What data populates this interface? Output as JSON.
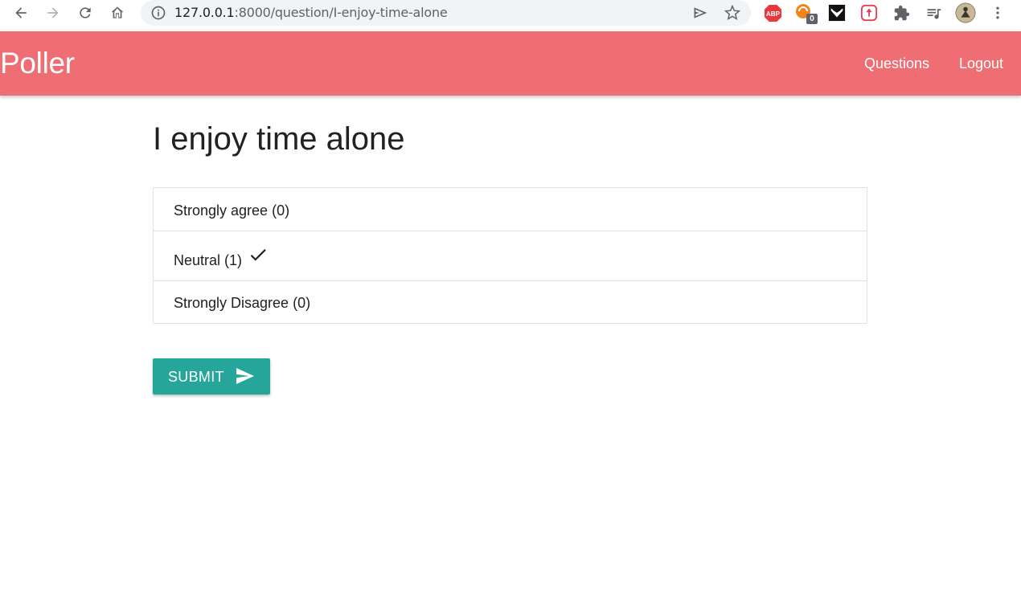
{
  "browser": {
    "url_host": "127.0.0.1",
    "url_path": ":8000/question/I-enjoy-time-alone",
    "extension_badge_count": "0",
    "abp_label": "ABP"
  },
  "navbar": {
    "brand": "Poller",
    "links": [
      "Questions",
      "Logout"
    ],
    "bg_color": "#ee6e73"
  },
  "question": {
    "title": "I enjoy time alone",
    "choices": [
      {
        "label": "Strongly agree (0)",
        "selected": false
      },
      {
        "label": "Neutral (1)",
        "selected": true
      },
      {
        "label": "Strongly Disagree (0)",
        "selected": false
      }
    ]
  },
  "form": {
    "submit_label": "SUBMIT",
    "submit_icon": "send-icon",
    "submit_color": "#26a69a"
  }
}
